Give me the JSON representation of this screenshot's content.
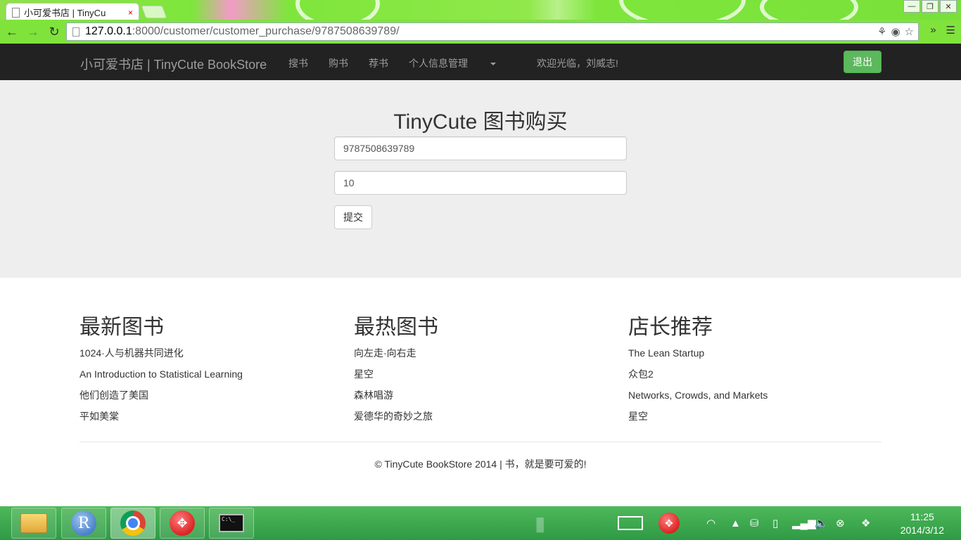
{
  "browser": {
    "tab_title": "小可爱书店 | TinyCu",
    "tab_close": "×",
    "url_host": "127.0.0.1",
    "url_path": ":8000/customer/customer_purchase/9787508639789/",
    "window_controls": [
      "—",
      "❐",
      "✕"
    ]
  },
  "navbar": {
    "brand": "小可爱书店 | TinyCute BookStore",
    "items": [
      "搜书",
      "购书",
      "荐书",
      "个人信息管理"
    ],
    "welcome": "欢迎光临，刘威志!",
    "logout": "退出"
  },
  "purchase": {
    "heading": "TinyCute 图书购买",
    "isbn_value": "9787508639789",
    "quantity_value": "10",
    "submit_label": "提交"
  },
  "columns": [
    {
      "title": "最新图书",
      "items": [
        "1024·人与机器共同进化",
        "An Introduction to Statistical Learning",
        "他们创造了美国",
        "平如美棠"
      ]
    },
    {
      "title": "最热图书",
      "items": [
        "向左走·向右走",
        "星空",
        "森林唱游",
        "爱德华的奇妙之旅"
      ]
    },
    {
      "title": "店长推荐",
      "items": [
        "The Lean Startup",
        "众包2",
        "Networks, Crowds, and Markets",
        "星空"
      ]
    }
  ],
  "footer": "© TinyCute BookStore 2014 | 书，就是要可爱的!",
  "taskbar": {
    "time": "11:25",
    "date": "2014/3/12",
    "r_label": "R"
  },
  "colors": {
    "navbar_bg": "#222222",
    "logout_bg": "#5cb85c",
    "jumbo_bg": "#eeeeee",
    "chrome_green": "#7fe33c",
    "taskbar_green": "#2f9a45"
  }
}
